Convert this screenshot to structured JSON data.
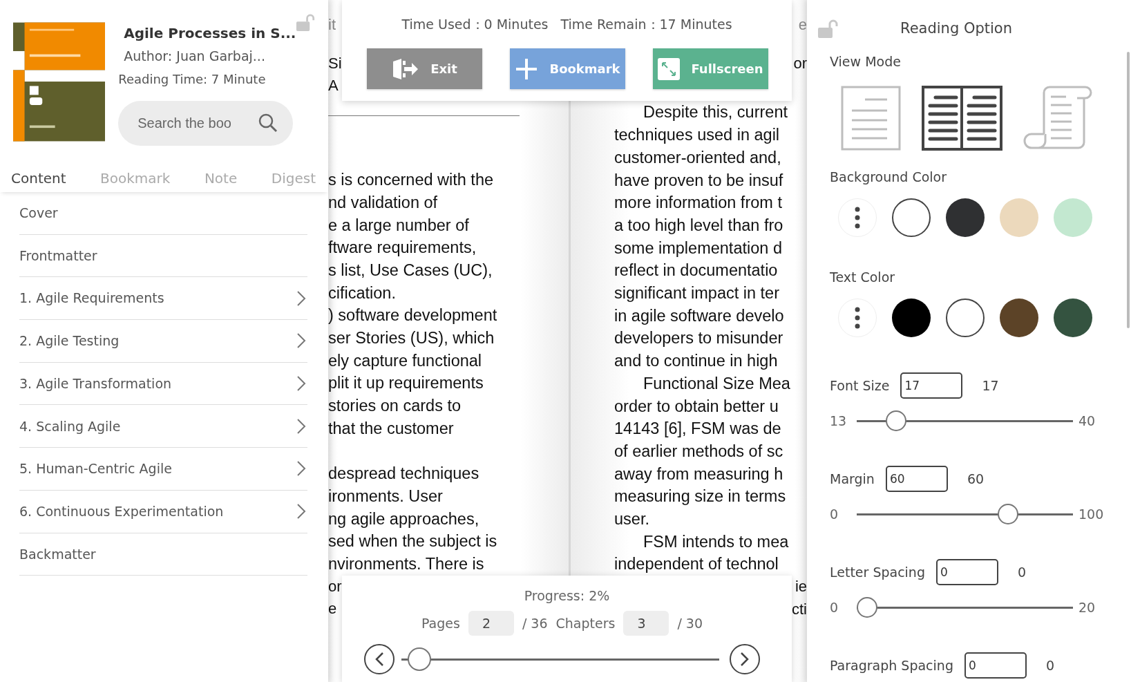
{
  "book": {
    "title": "Agile Processes in S...",
    "author": "Author: Juan Garbaj...",
    "reading_time": "Reading Time: 7 Minute"
  },
  "search": {
    "placeholder": "Search the boo"
  },
  "tabs": [
    {
      "label": "Content",
      "selected": true
    },
    {
      "label": "Bookmark",
      "selected": false
    },
    {
      "label": "Note",
      "selected": false
    },
    {
      "label": "Digest",
      "selected": false
    }
  ],
  "contents": [
    {
      "label": "Cover",
      "expandable": false
    },
    {
      "label": "Frontmatter",
      "expandable": false
    },
    {
      "label": "1. Agile Requirements",
      "expandable": true
    },
    {
      "label": "2. Agile Testing",
      "expandable": true
    },
    {
      "label": "3. Agile Transformation",
      "expandable": true
    },
    {
      "label": "4. Scaling Agile",
      "expandable": true
    },
    {
      "label": "5. Human-Centric Agile",
      "expandable": true
    },
    {
      "label": "6. Continuous Experimentation",
      "expandable": true
    },
    {
      "label": "Backmatter",
      "expandable": false
    }
  ],
  "left_page": {
    "header": "it",
    "top_lines": [
      "Si",
      "A"
    ],
    "paragraphs": [
      [
        "s is concerned with the",
        "nd validation of",
        "e a large number of",
        "ftware requirements,",
        "s list, Use Cases (UC),",
        "cification.",
        ") software development",
        "ser Stories (US), which",
        "ely capture functional",
        "plit it up requirements",
        "stories on cards to",
        "that the customer"
      ],
      [
        "despread techniques",
        "ironments. User",
        "ng agile approaches,",
        "sed when the subject is",
        "nvironments. There is"
      ]
    ],
    "bottom_lines": [
      "or",
      "e"
    ]
  },
  "right_page": {
    "header": "e",
    "top_lines": [
      "or"
    ],
    "paragraphs": [
      [
        "Despite this, current",
        "techniques used in agil",
        "customer-oriented and,",
        "have proven to be insuf",
        "more information from t",
        "a too high level than fro",
        "some implementation d",
        "reflect in documentatio",
        "significant impact in ter",
        "in agile software develo",
        "developers to misunder",
        "and to continue in high"
      ],
      [
        "Functional Size Mea",
        "order to obtain better u",
        "14143 [6], FSM was de",
        "of earlier methods of sc",
        "away from measuring h",
        "measuring size in terms",
        "user."
      ],
      [
        "FSM intends to mea",
        "independent of technol"
      ]
    ],
    "bottom_lines": [
      "ie",
      "cti"
    ]
  },
  "top_bar": {
    "time_used": "Time Used：0 Minutes",
    "time_remain": "Time Remain：17 Minutes",
    "buttons": [
      {
        "label": "Exit",
        "kind": "exit"
      },
      {
        "label": "Bookmark",
        "kind": "bookmark"
      },
      {
        "label": "Fullscreen",
        "kind": "fullscreen"
      }
    ]
  },
  "progress": {
    "label": "Progress: 2%",
    "pages_label": "Pages",
    "page": "2",
    "pages_total": "/ 36",
    "chapters_label": "Chapters",
    "chapter": "3",
    "chapters_total": "/ 30",
    "level": 0.02
  },
  "reading_option": {
    "title": "Reading Option",
    "view_mode_label": "View Mode",
    "view_modes": [
      {
        "kind": "single",
        "selected": false
      },
      {
        "kind": "double",
        "selected": true
      },
      {
        "kind": "scroll",
        "selected": false
      }
    ],
    "background_label": "Background Color",
    "background_colors": [
      {
        "kind": "more"
      },
      {
        "kind": "swatch",
        "color": "#ffffff"
      },
      {
        "kind": "swatch",
        "color": "#2f3032"
      },
      {
        "kind": "swatch",
        "color": "#ecd9bc"
      },
      {
        "kind": "swatch",
        "color": "#c3e8d0"
      }
    ],
    "text_color_label": "Text Color",
    "text_colors": [
      {
        "kind": "more"
      },
      {
        "kind": "swatch",
        "color": "#000000"
      },
      {
        "kind": "swatch",
        "color": "#ffffff"
      },
      {
        "kind": "swatch",
        "color": "#5c4327"
      },
      {
        "kind": "swatch",
        "color": "#345340"
      }
    ],
    "settings": [
      {
        "label": "Font Size",
        "value": "17",
        "reading": "17",
        "min": "13",
        "max": "40",
        "level": 0.15
      },
      {
        "label": "Margin",
        "value": "60",
        "reading": "60",
        "min": "0",
        "max": "100",
        "level": 0.72
      },
      {
        "label": "Letter Spacing",
        "value": "0",
        "reading": "0",
        "min": "0",
        "max": "20",
        "level": 0
      },
      {
        "label": "Paragraph Spacing",
        "value": "0",
        "reading": "0"
      }
    ]
  }
}
